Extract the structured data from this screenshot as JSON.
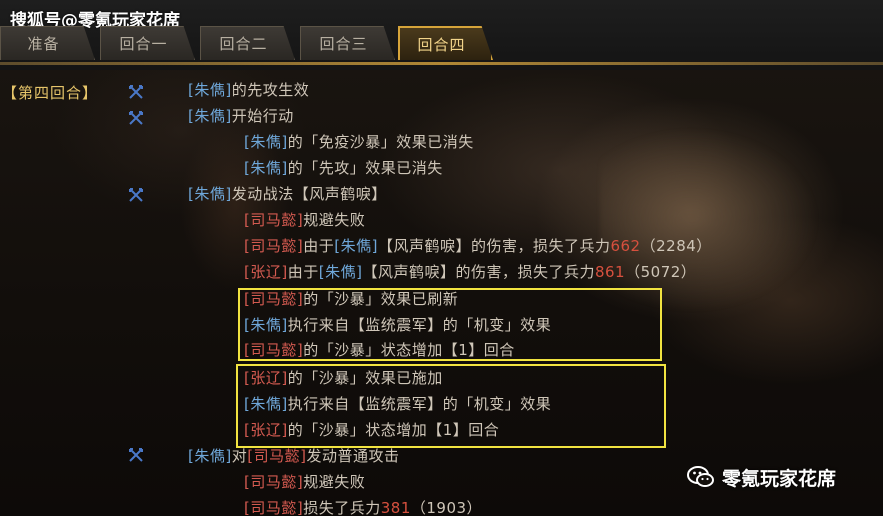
{
  "watermark_top": "搜狐号@零氪玩家花席",
  "watermark_bottom": "零氪玩家花席",
  "tabs": [
    {
      "label": "准备",
      "active": false
    },
    {
      "label": "回合一",
      "active": false
    },
    {
      "label": "回合二",
      "active": false
    },
    {
      "label": "回合三",
      "active": false
    },
    {
      "label": "回合四",
      "active": true
    }
  ],
  "round_label": "【第四回合】",
  "colors": {
    "ally": "#6fa7d9",
    "enemy": "#d35a50",
    "damage": "#d6503e",
    "highlight": "#f1e340",
    "accent": "#d6a43a"
  },
  "icon_names": {
    "action": "crossed-swords-icon",
    "wechat": "wechat-icon"
  },
  "log": [
    {
      "subject": "[朱儁]",
      "text": "的先攻生效"
    },
    {
      "subject": "[朱儁]",
      "text": "开始行动"
    },
    {
      "subject": "[朱儁]",
      "text": "的「免疫沙暴」效果已消失"
    },
    {
      "subject": "[朱儁]",
      "text": "的「先攻」效果已消失"
    },
    {
      "subject": "[朱儁]",
      "text": "发动战法【风声鹤唳】"
    },
    {
      "subject": "[司马懿]",
      "text": "规避失败"
    },
    {
      "subject": "[司马懿]",
      "pre": "由于",
      "source": "[朱儁]",
      "text": "【风声鹤唳】的伤害，损失了兵力",
      "dmg": "662",
      "remain": "（2284）"
    },
    {
      "subject": "[张辽]",
      "pre": "由于",
      "source": "[朱儁]",
      "text": "【风声鹤唳】的伤害，损失了兵力",
      "dmg": "861",
      "remain": "（5072）"
    },
    {
      "subject": "[司马懿]",
      "text": "的「沙暴」效果已刷新"
    },
    {
      "subject": "[朱儁]",
      "text": "执行来自【监统震军】的「机变」效果"
    },
    {
      "subject": "[司马懿]",
      "text": "的「沙暴」状态增加【1】回合"
    },
    {
      "subject": "[张辽]",
      "text": "的「沙暴」效果已施加"
    },
    {
      "subject": "[朱儁]",
      "text": "执行来自【监统震军】的「机变」效果"
    },
    {
      "subject": "[张辽]",
      "text": "的「沙暴」状态增加【1】回合"
    },
    {
      "subject": "[朱儁]",
      "pre": "对",
      "target": "[司马懿]",
      "text": "发动普通攻击"
    },
    {
      "subject": "[司马懿]",
      "text": "规避失败"
    },
    {
      "subject": "[司马懿]",
      "text": "损失了兵力",
      "dmg": "381",
      "remain": "（1903）"
    }
  ]
}
